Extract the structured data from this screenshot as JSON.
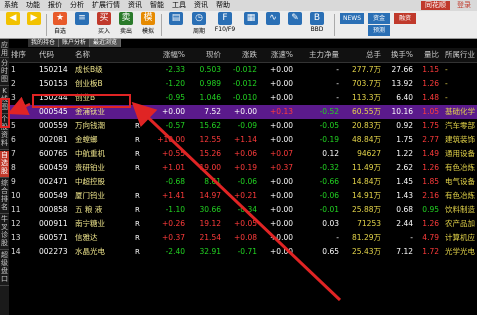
{
  "menu": {
    "items": [
      "系统",
      "功能",
      "报价",
      "分析",
      "扩展行情",
      "资讯",
      "智能",
      "工具",
      "资讯",
      "帮助"
    ],
    "app_logo": "同花顺",
    "login": "登录"
  },
  "toolbar": {
    "buttons": [
      {
        "label": "",
        "icon": "back-icon",
        "color": "#f2c200"
      },
      {
        "label": "",
        "icon": "forward-icon",
        "color": "#f2c200"
      },
      {
        "label": "自选",
        "icon": "star-icon",
        "color": "#e85a2a"
      },
      {
        "label": "",
        "icon": "list-icon",
        "color": "#2a6fb5"
      },
      {
        "label": "买入",
        "icon": "buy-icon",
        "color": "#c0392b"
      },
      {
        "label": "卖出",
        "icon": "sell-icon",
        "color": "#2a7a2a"
      },
      {
        "label": "模拟",
        "icon": "sim-icon",
        "color": "#e68a00"
      },
      {
        "label": "",
        "icon": "chart-icon",
        "color": "#2a6fb5"
      },
      {
        "label": "周期",
        "icon": "period-icon",
        "color": "#2a6fb5"
      },
      {
        "label": "F10/F9",
        "icon": "f10-icon",
        "color": "#2a6fb5"
      },
      {
        "label": "",
        "icon": "news-icon",
        "color": "#2a6fb5"
      },
      {
        "label": "",
        "icon": "indicator-icon",
        "color": "#2a6fb5"
      },
      {
        "label": "",
        "icon": "tool-icon",
        "color": "#2a6fb5"
      },
      {
        "label": "BBD",
        "icon": "bbd-icon",
        "color": "#2a6fb5"
      }
    ],
    "chips": {
      "news": "NEWS",
      "fund": "资金",
      "money": "融资",
      "cloud": "预测"
    }
  },
  "sidetabs": [
    "应用",
    "分时图",
    "K线图",
    "个股资料",
    "自选股",
    "综合排名",
    "牛叉诊股",
    "超级盘口"
  ],
  "tabs": [
    "我的持仓",
    "账户分析",
    "最近浏览"
  ],
  "table": {
    "headers": [
      "排序",
      "代码",
      "名称",
      "涨幅%",
      "现价",
      "涨跌",
      "涨速%",
      "主力净量",
      "总手",
      "换手%",
      "量比",
      "所属行业"
    ],
    "rows": [
      {
        "idx": "1",
        "code": "150214",
        "name": "成长B级",
        "flag": "",
        "pct": "-2.33",
        "price": "0.503",
        "chg": "-0.012",
        "speed": "+0.00",
        "main": "-",
        "vol": "277.7万",
        "turn": "27.66",
        "ratio": "1.15",
        "ind": "-"
      },
      {
        "idx": "2",
        "code": "150153",
        "name": "创业板B",
        "flag": "",
        "pct": "-1.20",
        "price": "0.989",
        "chg": "-0.012",
        "speed": "+0.00",
        "main": "-",
        "vol": "703.7万",
        "turn": "13.92",
        "ratio": "1.26",
        "ind": "-"
      },
      {
        "idx": "3",
        "code": "150244",
        "name": "创业B",
        "flag": "",
        "pct": "-0.95",
        "price": "1.046",
        "chg": "-0.010",
        "speed": "+0.00",
        "main": "-",
        "vol": "113.3万",
        "turn": "6.40",
        "ratio": "1.48",
        "ind": "-"
      },
      {
        "idx": "4",
        "code": "000545",
        "name": "金浦钛业",
        "flag": "",
        "pct": "+0.00",
        "price": "7.52",
        "chg": "+0.00",
        "speed": "+0.13",
        "main": "-0.52",
        "vol": "60.55万",
        "turn": "10.16",
        "ratio": "1.05",
        "ind": "基础化学"
      },
      {
        "idx": "5",
        "code": "000559",
        "name": "万向钱潮",
        "flag": "R",
        "pct": "-0.57",
        "price": "15.62",
        "chg": "-0.09",
        "speed": "+0.00",
        "main": "-0.05",
        "vol": "20.83万",
        "turn": "0.92",
        "ratio": "1.75",
        "ind": "汽车零部"
      },
      {
        "idx": "6",
        "code": "002081",
        "name": "金螳螂",
        "flag": "R",
        "pct": "+10.00",
        "price": "12.55",
        "chg": "+1.14",
        "speed": "+0.00",
        "main": "-0.19",
        "vol": "48.84万",
        "turn": "1.75",
        "ratio": "2.77",
        "ind": "建筑装饰"
      },
      {
        "idx": "7",
        "code": "600765",
        "name": "中航重机",
        "flag": "R",
        "pct": "+0.55",
        "price": "15.26",
        "chg": "+0.06",
        "speed": "+0.07",
        "main": "0.12",
        "vol": "94627",
        "turn": "1.22",
        "ratio": "1.49",
        "ind": "通用设备"
      },
      {
        "idx": "8",
        "code": "600459",
        "name": "贵研铂业",
        "flag": "R",
        "pct": "+1.01",
        "price": "19.00",
        "chg": "+0.19",
        "speed": "+0.37",
        "main": "-0.32",
        "vol": "11.49万",
        "turn": "2.62",
        "ratio": "1.26",
        "ind": "有色冶炼"
      },
      {
        "idx": "9",
        "code": "002471",
        "name": "中超控股",
        "flag": "",
        "pct": "-0.68",
        "price": "8.61",
        "chg": "-0.06",
        "speed": "+0.00",
        "main": "-0.66",
        "vol": "14.84万",
        "turn": "1.45",
        "ratio": "1.85",
        "ind": "电气设备"
      },
      {
        "idx": "10",
        "code": "600549",
        "name": "厦门钨业",
        "flag": "R",
        "pct": "+1.41",
        "price": "14.97",
        "chg": "+0.21",
        "speed": "+0.00",
        "main": "-0.06",
        "vol": "14.91万",
        "turn": "1.43",
        "ratio": "2.16",
        "ind": "有色冶炼"
      },
      {
        "idx": "11",
        "code": "000858",
        "name": "五 粮 液",
        "flag": "R",
        "pct": "-1.10",
        "price": "30.66",
        "chg": "-0.34",
        "speed": "+0.00",
        "main": "-0.01",
        "vol": "25.88万",
        "turn": "0.68",
        "ratio": "0.95",
        "ind": "饮料制造"
      },
      {
        "idx": "12",
        "code": "000911",
        "name": "南宁糖业",
        "flag": "R",
        "pct": "+0.26",
        "price": "19.12",
        "chg": "+0.05",
        "speed": "+0.00",
        "main": "0.03",
        "vol": "71253",
        "turn": "2.44",
        "ratio": "1.26",
        "ind": "农产品加"
      },
      {
        "idx": "13",
        "code": "600571",
        "name": "信雅达",
        "flag": "R",
        "pct": "+0.37",
        "price": "21.54",
        "chg": "+0.08",
        "speed": "+0.00",
        "main": "-",
        "vol": "81.29万",
        "turn": "-",
        "ratio": "4.79",
        "ind": "计算机应"
      },
      {
        "idx": "14",
        "code": "002273",
        "name": "水晶光电",
        "flag": "R",
        "pct": "-2.40",
        "price": "32.91",
        "chg": "-0.71",
        "speed": "+0.00",
        "main": "0.65",
        "vol": "25.43万",
        "turn": "7.12",
        "ratio": "1.72",
        "ind": "光学光电"
      }
    ]
  },
  "colors": {
    "up": "#ff3b3b",
    "down": "#22d422",
    "selected": "#5b1a8c",
    "annotation": "#e02424"
  }
}
